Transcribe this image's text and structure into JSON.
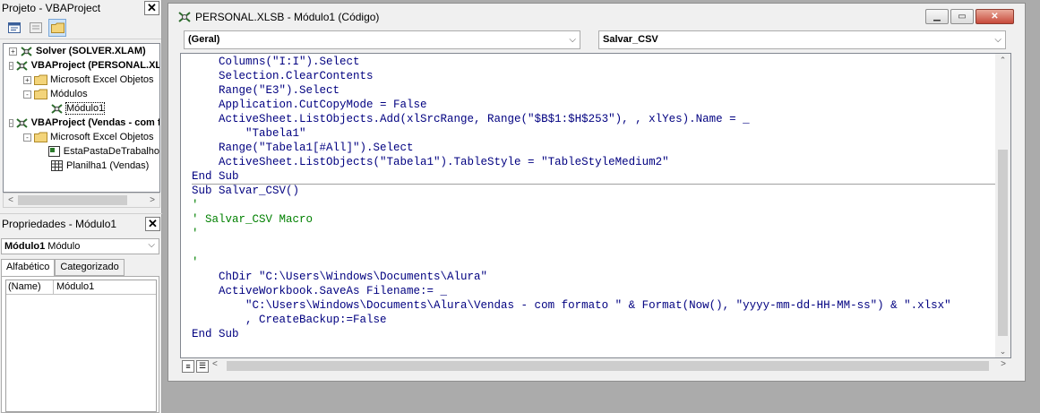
{
  "project_pane": {
    "title": "Projeto - VBAProject",
    "tree": [
      {
        "label": "Solver (SOLVER.XLAM)",
        "level": 0,
        "bold": true,
        "expander": "+"
      },
      {
        "label": "VBAProject (PERSONAL.XLSB)",
        "level": 0,
        "bold": true,
        "expander": "-"
      },
      {
        "label": "Microsoft Excel Objetos",
        "level": 1,
        "bold": false,
        "expander": "+"
      },
      {
        "label": "Módulos",
        "level": 1,
        "bold": false,
        "expander": "-"
      },
      {
        "label": "Módulo1",
        "level": 2,
        "bold": false,
        "expander": ""
      },
      {
        "label": "VBAProject (Vendas - com formato)",
        "level": 0,
        "bold": true,
        "expander": "-"
      },
      {
        "label": "Microsoft Excel Objetos",
        "level": 1,
        "bold": false,
        "expander": "-"
      },
      {
        "label": "EstaPastaDeTrabalho",
        "level": 2,
        "bold": false,
        "expander": ""
      },
      {
        "label": "Planilha1 (Vendas)",
        "level": 2,
        "bold": false,
        "expander": ""
      }
    ]
  },
  "properties_pane": {
    "title": "Propriedades - Módulo1",
    "object_name": "Módulo1",
    "object_type": "Módulo",
    "tabs": [
      "Alfabético",
      "Categorizado"
    ],
    "rows": [
      {
        "name": "(Name)",
        "value": "Módulo1"
      }
    ]
  },
  "code_window": {
    "title": "PERSONAL.XLSB - Módulo1 (Código)",
    "object_combo": "(Geral)",
    "procedure_combo": "Salvar_CSV",
    "lines": [
      {
        "text": "    Columns(\"I:I\").Select",
        "comment": false
      },
      {
        "text": "    Selection.ClearContents",
        "comment": false
      },
      {
        "text": "    Range(\"E3\").Select",
        "comment": false
      },
      {
        "text": "    Application.CutCopyMode = False",
        "comment": false
      },
      {
        "text": "    ActiveSheet.ListObjects.Add(xlSrcRange, Range(\"$B$1:$H$253\"), , xlYes).Name = _",
        "comment": false
      },
      {
        "text": "        \"Tabela1\"",
        "comment": false
      },
      {
        "text": "    Range(\"Tabela1[#All]\").Select",
        "comment": false
      },
      {
        "text": "    ActiveSheet.ListObjects(\"Tabela1\").TableStyle = \"TableStyleMedium2\"",
        "comment": false
      },
      {
        "text": "End Sub",
        "comment": false
      },
      {
        "text": "Sub Salvar_CSV()",
        "comment": false
      },
      {
        "text": "'",
        "comment": true
      },
      {
        "text": "' Salvar_CSV Macro",
        "comment": true
      },
      {
        "text": "'",
        "comment": true
      },
      {
        "text": "",
        "comment": false
      },
      {
        "text": "'",
        "comment": true
      },
      {
        "text": "    ChDir \"C:\\Users\\Windows\\Documents\\Alura\"",
        "comment": false
      },
      {
        "text": "    ActiveWorkbook.SaveAs Filename:= _",
        "comment": false
      },
      {
        "text": "        \"C:\\Users\\Windows\\Documents\\Alura\\Vendas - com formato \" & Format(Now(), \"yyyy-mm-dd-HH-MM-ss\") & \".xlsx\"",
        "comment": false
      },
      {
        "text": "        , CreateBackup:=False",
        "comment": false
      },
      {
        "text": "End Sub",
        "comment": false
      }
    ]
  },
  "colors": {
    "keyword": "#000080",
    "comment": "#008000",
    "close_button": "#c7493a"
  },
  "icons": {
    "view_code": "view-code-icon",
    "view_object": "view-object-icon",
    "toggle_folders": "folder-icon",
    "project": "vba-project-icon",
    "module": "module-icon",
    "sheet": "sheet-icon"
  }
}
